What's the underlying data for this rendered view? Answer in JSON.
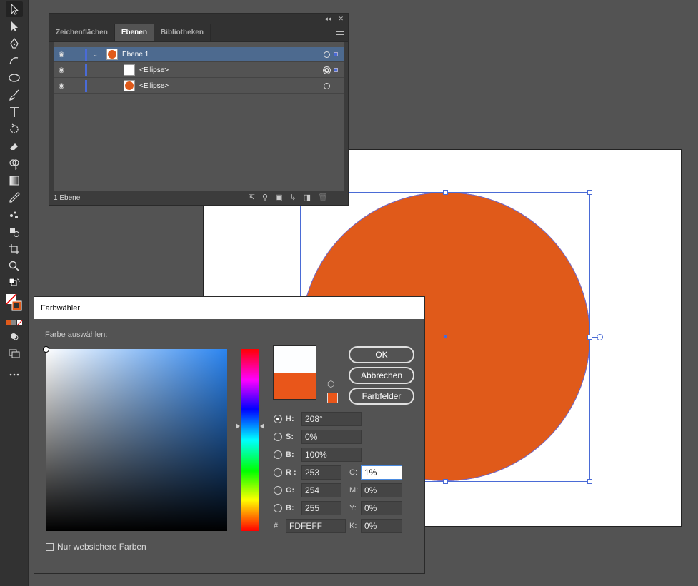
{
  "colors": {
    "accent": "#4a6bd6",
    "fill": "#e05a1a",
    "canvas": "#535353",
    "new_color": "#fdfeff",
    "old_color": "#e9561a"
  },
  "toolbar": {
    "tools": [
      "selection",
      "direct-selection",
      "pen",
      "curvature",
      "ellipse",
      "paintbrush",
      "type",
      "rotate",
      "eraser",
      "shape-builder",
      "gradient",
      "eyedropper",
      "blend",
      "symbol-sprayer",
      "artboard",
      "zoom",
      "fill-stroke",
      "color-modes",
      "draw-modes",
      "screen-modes",
      "more"
    ]
  },
  "layers_panel": {
    "tabs": [
      {
        "label": "Zeichenflächen"
      },
      {
        "label": "Ebenen"
      },
      {
        "label": "Bibliotheken"
      }
    ],
    "active_tab": "Ebenen",
    "rows": [
      {
        "name": "Ebene 1"
      },
      {
        "name": "<Ellipse>"
      },
      {
        "name": "<Ellipse>"
      }
    ],
    "footer_label": "1 Ebene"
  },
  "color_picker": {
    "title": "Farbwähler",
    "select_label": "Farbe auswählen:",
    "buttons": {
      "ok": "OK",
      "cancel": "Abbrechen",
      "swatches": "Farbfelder"
    },
    "fields": {
      "h": {
        "label": "H:",
        "value": "208°"
      },
      "s": {
        "label": "S:",
        "value": "0%"
      },
      "b": {
        "label": "B:",
        "value": "100%"
      },
      "r": {
        "label": "R :",
        "value": "253"
      },
      "g": {
        "label": "G:",
        "value": "254"
      },
      "b2": {
        "label": "B:",
        "value": "255"
      },
      "hex": {
        "label": "#",
        "value": "FDFEFF"
      },
      "c": {
        "label": "C:",
        "value": "1%"
      },
      "m": {
        "label": "M:",
        "value": "0%"
      },
      "y": {
        "label": "Y:",
        "value": "0%"
      },
      "k": {
        "label": "K:",
        "value": "0%"
      }
    },
    "websafe_label": "Nur websichere Farben"
  }
}
